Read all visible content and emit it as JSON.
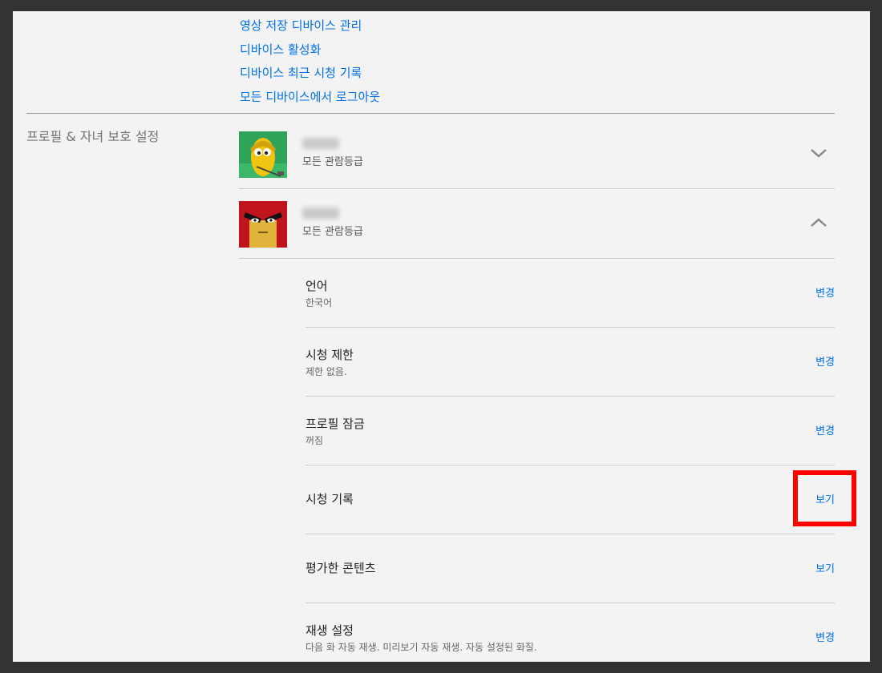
{
  "device_links": [
    "영상 저장 디바이스 관리",
    "디바이스 활성화",
    "디바이스 최근 시청 기록",
    "모든 디바이스에서 로그아웃"
  ],
  "section_title": "프로필 & 자녀 보호 설정",
  "profiles": [
    {
      "rating": "모든 관람등급",
      "avatar_icon": "yellow-character-avatar-icon",
      "expanded": false
    },
    {
      "rating": "모든 관람등급",
      "avatar_icon": "red-character-avatar-icon",
      "expanded": true
    }
  ],
  "settings": [
    {
      "label": "언어",
      "value": "한국어",
      "action": "변경"
    },
    {
      "label": "시청 제한",
      "value": "제한 없음.",
      "action": "변경"
    },
    {
      "label": "프로필 잠금",
      "value": "꺼짐",
      "action": "변경"
    },
    {
      "label": "시청 기록",
      "value": "",
      "action": "보기"
    },
    {
      "label": "평가한 콘텐츠",
      "value": "",
      "action": "보기"
    },
    {
      "label": "재생 설정",
      "value": "다음 화 자동 재생. 미리보기 자동 재생. 자동 설정된 화질.",
      "action": "변경"
    }
  ],
  "colors": {
    "link": "#0071eb",
    "highlight": "#ff0000",
    "background": "#f3f3f3",
    "outer": "#333333"
  }
}
